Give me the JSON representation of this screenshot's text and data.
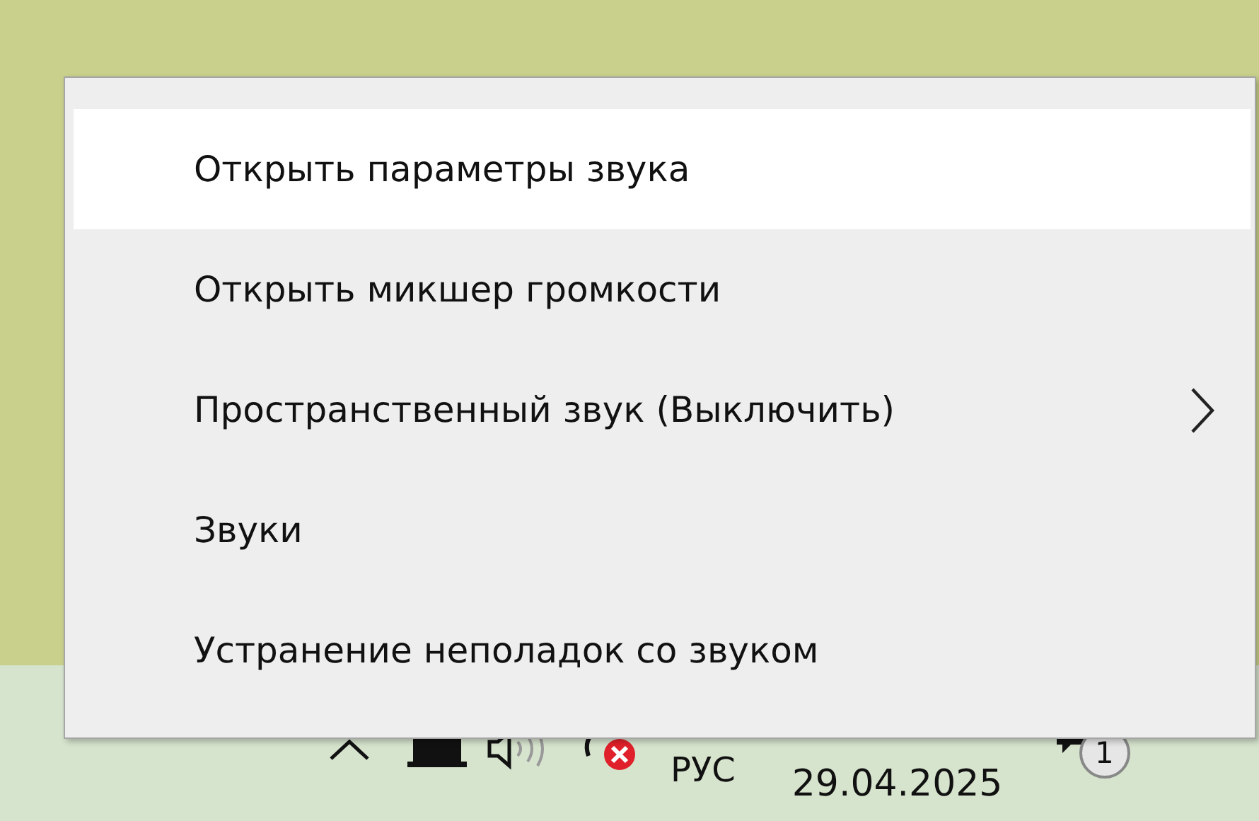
{
  "context_menu": {
    "items": [
      {
        "label": "Открыть параметры звука",
        "selected": true,
        "kind": "item"
      },
      {
        "label": "Открыть микшер громкости",
        "selected": false,
        "kind": "item"
      },
      {
        "label": "Пространственный звук (Выключить)",
        "selected": false,
        "kind": "submenu"
      },
      {
        "label": "Звуки",
        "selected": false,
        "kind": "item"
      },
      {
        "label": "Устранение неполадок со звуком",
        "selected": false,
        "kind": "item"
      }
    ]
  },
  "taskbar": {
    "language": "РУС",
    "date": "29.04.2025",
    "notification_count": "1"
  }
}
